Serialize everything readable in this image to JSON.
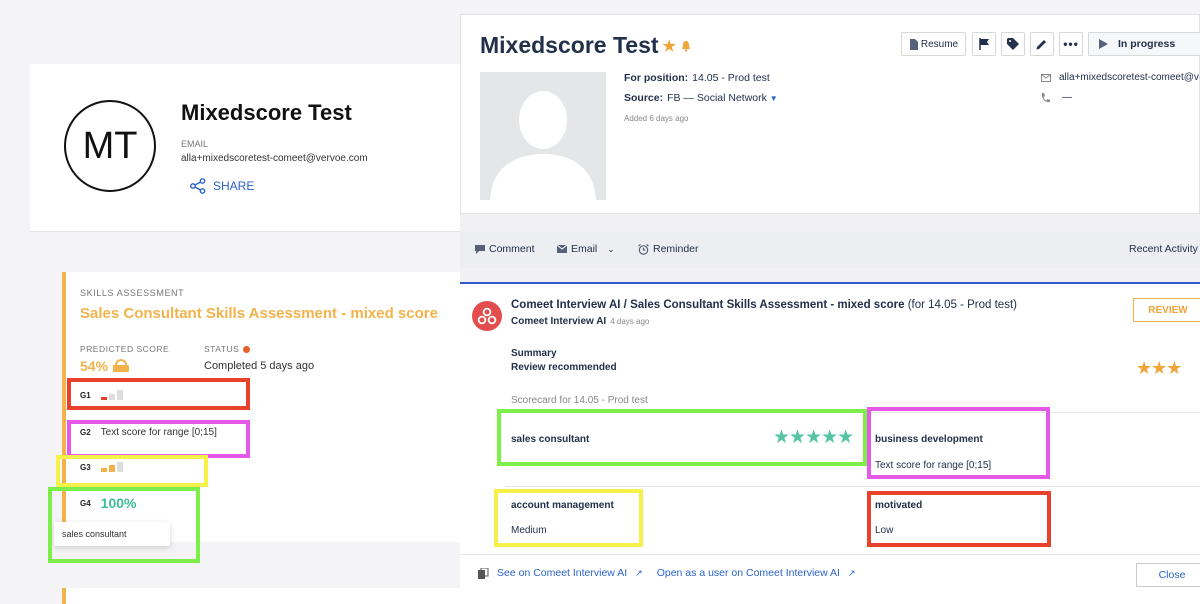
{
  "left": {
    "avatar_initials": "MT",
    "name": "Mixedscore Test",
    "email_label": "EMAIL",
    "email": "alla+mixedscoretest-comeet@vervoe.com",
    "share_label": "SHARE",
    "assessment": {
      "kicker": "SKILLS ASSESSMENT",
      "title": "Sales Consultant Skills Assessment - mixed score",
      "predicted_label": "PREDICTED SCORE",
      "predicted_value": "54%",
      "status_label": "STATUS",
      "status_value": "Completed 5 days ago",
      "groups": [
        {
          "id": "G1",
          "bars_filled": 1
        },
        {
          "id": "G2",
          "text": "Text score for range [0;15]"
        },
        {
          "id": "G3",
          "bars_filled": 2
        },
        {
          "id": "G4",
          "value": "100%"
        }
      ],
      "tooltip": "sales consultant"
    }
  },
  "right": {
    "name": "Mixedscore Test",
    "toolbar": {
      "resume": "Resume",
      "status": "In progress"
    },
    "position_label": "For position:",
    "position_value": "14.05 - Prod test",
    "source_label": "Source:",
    "source_value": "FB — Social Network",
    "added": "Added 6 days ago",
    "contact_email": "alla+mixedscoretest-comeet@v",
    "contact_phone": "—",
    "actions": {
      "comment": "Comment",
      "email": "Email",
      "reminder": "Reminder",
      "recent": "Recent Activity"
    },
    "card": {
      "title_bold": "Comeet Interview AI / Sales Consultant Skills Assessment - mixed score",
      "title_rest": "(for 14.05 - Prod test)",
      "sub_author": "Comeet Interview AI",
      "sub_time": "4 days ago",
      "badge": "REVIEW",
      "summary_label": "Summary",
      "summary_value": "Review recommended",
      "summary_stars": 3,
      "scorecard": "Scorecard for 14.05 - Prod test",
      "items": [
        {
          "label": "sales consultant",
          "stars": 5
        },
        {
          "label": "business development",
          "value": "Text score for range [0;15]"
        },
        {
          "label": "account management",
          "value": "Medium"
        },
        {
          "label": "motivated",
          "value": "Low"
        }
      ],
      "link_see": "See on Comeet Interview AI",
      "link_open": "Open as a user on Comeet Interview AI",
      "close": "Close"
    }
  },
  "colors": {
    "red_box": "#e8412c",
    "magenta_box": "#e658e8",
    "yellow_box": "#f5f04a",
    "green_box": "#7eef4a",
    "accent_orange": "#f3b34a",
    "teal_stars": "#56c3a4"
  }
}
